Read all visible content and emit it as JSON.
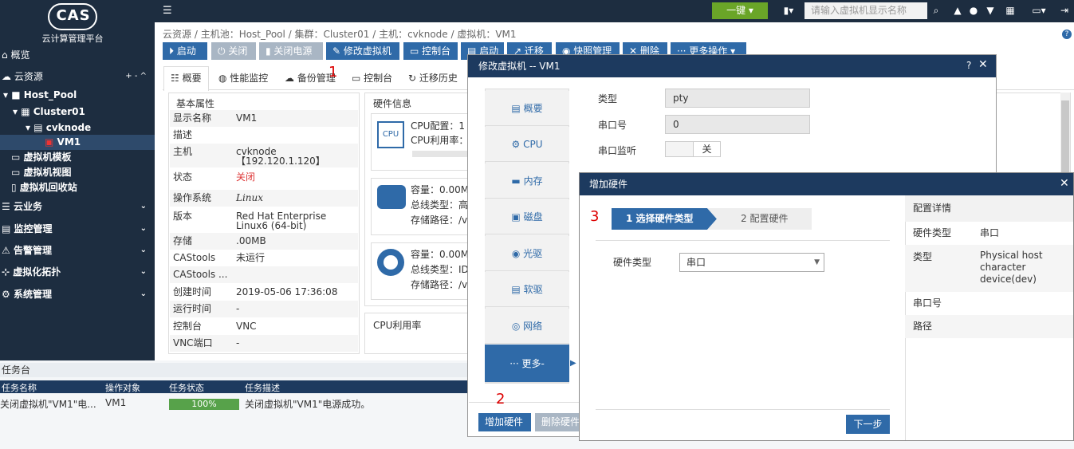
{
  "app": {
    "logo_text": "CAS",
    "subtitle": "云计算管理平台"
  },
  "sidebar": {
    "items": [
      {
        "label": "概览",
        "icon": "home-icon"
      },
      {
        "label": "云资源",
        "icon": "cloud-icon",
        "actions": "+ - ^"
      },
      {
        "label": "Host_Pool",
        "icon": "folder-icon"
      },
      {
        "label": "Cluster01",
        "icon": "cluster-icon"
      },
      {
        "label": "cvknode",
        "icon": "host-icon"
      },
      {
        "label": "VM1",
        "icon": "vm-icon"
      },
      {
        "label": "虚拟机模板",
        "icon": "template-icon"
      },
      {
        "label": "虚拟机视图",
        "icon": "view-icon"
      },
      {
        "label": "虚拟机回收站",
        "icon": "trash-icon"
      },
      {
        "label": "云业务",
        "icon": "service-icon"
      },
      {
        "label": "监控管理",
        "icon": "monitor-icon"
      },
      {
        "label": "告警管理",
        "icon": "alarm-icon"
      },
      {
        "label": "虚拟化拓扑",
        "icon": "topology-icon"
      },
      {
        "label": "系统管理",
        "icon": "system-icon"
      }
    ]
  },
  "topbar": {
    "one_key": "一键",
    "search_placeholder": "请输入虚拟机显示名称"
  },
  "breadcrumb": [
    "云资源",
    "主机池：Host_Pool",
    "集群：Cluster01",
    "主机：cvknode",
    "虚拟机：VM1"
  ],
  "toolbar": {
    "start": "启动",
    "shutdown": "关闭",
    "power_off": "关闭电源",
    "edit_vm": "修改虚拟机",
    "console": "控制台",
    "more1": "启动",
    "migrate": "迁移",
    "snapshot": "快照管理",
    "delete": "删除",
    "more": "更多操作"
  },
  "tabs": {
    "overview": "概要",
    "perf": "性能监控",
    "backup": "备份管理",
    "console": "控制台",
    "migrate_history": "迁移历史"
  },
  "basic": {
    "title": "基本属性",
    "rows": [
      {
        "k": "显示名称",
        "v": "VM1"
      },
      {
        "k": "描述",
        "v": ""
      },
      {
        "k": "主机",
        "v": "cvknode 【192.120.1.120】"
      },
      {
        "k": "状态",
        "v": "关闭"
      },
      {
        "k": "操作系统",
        "v": "Linux"
      },
      {
        "k": "版本",
        "v": "Red Hat Enterprise Linux6 (64-bit)"
      },
      {
        "k": "存储",
        "v": ".00MB"
      },
      {
        "k": "CAStools",
        "v": "未运行"
      },
      {
        "k": "CAStools ...",
        "v": ""
      },
      {
        "k": "创建时间",
        "v": "2019-05-06 17:36:08"
      },
      {
        "k": "运行时间",
        "v": "-"
      },
      {
        "k": "控制台",
        "v": "VNC"
      },
      {
        "k": "VNC端口",
        "v": "-"
      }
    ]
  },
  "hardware": {
    "title": "硬件信息",
    "cpu_config": "CPU配置：1",
    "cpu_util": "CPU利用率：",
    "disk_cap": "容量：0.00M",
    "disk_bus": "总线类型：高",
    "disk_path": "存储路径：/v",
    "cd_cap": "容量：0.00M",
    "cd_bus": "总线类型：ID",
    "cd_path": "存储路径：/v",
    "cpu_chart_title": "CPU利用率"
  },
  "annotations": {
    "n1": "1",
    "n2": "2",
    "n3": "3"
  },
  "taskbar": {
    "title": "任务台",
    "headers": [
      "任务名称",
      "操作对象",
      "任务状态",
      "任务描述"
    ],
    "row": {
      "name": "关闭虚拟机\"VM1\"电...",
      "target": "VM1",
      "progress": "100%",
      "progress_value": 100,
      "desc": "关闭虚拟机\"VM1\"电源成功。"
    }
  },
  "modal_edit": {
    "title": "修改虚拟机 -- VM1",
    "help": "?",
    "nav": [
      "概要",
      "CPU",
      "内存",
      "磁盘",
      "光驱",
      "软驱",
      "网络",
      "··· 更多-"
    ],
    "type_label": "类型",
    "type_value": "pty",
    "port_label": "串口号",
    "port_value": "0",
    "listen_label": "串口监听",
    "listen_value": "关",
    "add_hw": "增加硬件",
    "remove_hw": "删除硬件"
  },
  "modal_add": {
    "title": "增加硬件",
    "step1": "1 选择硬件类型",
    "step2": "2 配置硬件",
    "hw_type_label": "硬件类型",
    "hw_type_value": "串口",
    "next": "下一步",
    "details_title": "配置详情",
    "details": [
      {
        "k": "硬件类型",
        "v": "串口"
      },
      {
        "k": "类型",
        "v": "Physical host character device(dev)"
      },
      {
        "k": "串口号",
        "v": ""
      },
      {
        "k": "路径",
        "v": ""
      }
    ]
  }
}
